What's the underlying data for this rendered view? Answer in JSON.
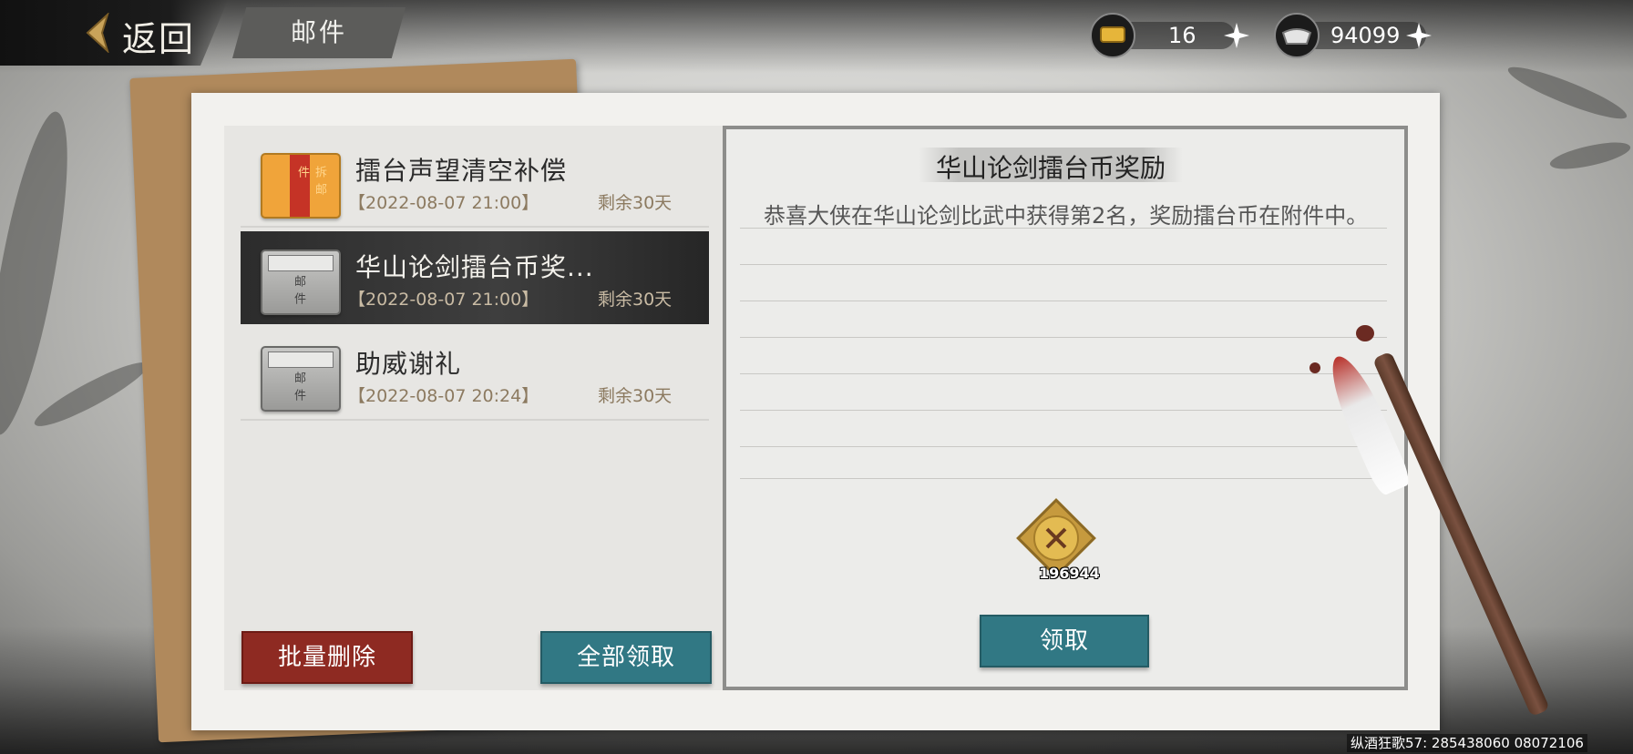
{
  "header": {
    "back_label": "返回",
    "tab_label": "邮件"
  },
  "currencies": [
    {
      "icon": "gold-ingot-icon",
      "value": "16"
    },
    {
      "icon": "silver-ingot-icon",
      "value": "94099"
    }
  ],
  "mail_list": [
    {
      "title": "擂台声望清空补偿",
      "date": "【2022-08-07 21:00】",
      "remaining": "剩余30天",
      "envelope": "opened-red-envelope-icon",
      "seal": "拆邮件"
    },
    {
      "title": "华山论剑擂台币奖...",
      "date": "【2022-08-07 21:00】",
      "remaining": "剩余30天",
      "envelope": "closed-grey-envelope-icon",
      "seal": "邮件"
    },
    {
      "title": "助威谢礼",
      "date": "【2022-08-07 20:24】",
      "remaining": "剩余30天",
      "envelope": "closed-grey-envelope-icon",
      "seal": "邮件"
    }
  ],
  "actions": {
    "batch_delete": "批量删除",
    "claim_all": "全部领取"
  },
  "detail": {
    "title": "华山论剑擂台币奖励",
    "body": "恭喜大侠在华山论剑比武中获得第2名，奖励擂台币在附件中。",
    "attachment": {
      "icon": "arena-coin-icon",
      "quantity": "196944"
    },
    "claim_button": "领取"
  },
  "watermark": "纵酒狂歌57: 285438060 08072106",
  "colors": {
    "red_button": "#8e2a22",
    "teal_button": "#317884",
    "selected_row": "#2c2c2c"
  }
}
